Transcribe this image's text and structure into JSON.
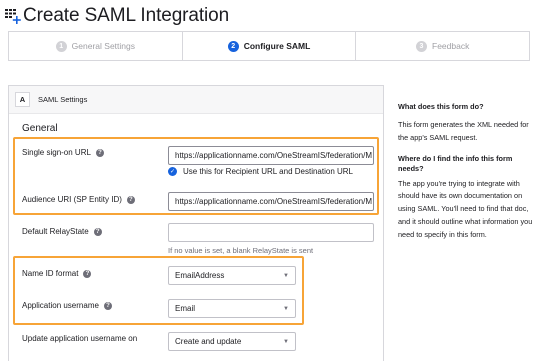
{
  "page": {
    "title": "Create SAML Integration"
  },
  "steps": [
    {
      "num": "1",
      "label": "General Settings"
    },
    {
      "num": "2",
      "label": "Configure SAML"
    },
    {
      "num": "3",
      "label": "Feedback"
    }
  ],
  "card": {
    "badge": "A",
    "header": "SAML Settings",
    "section": "General"
  },
  "fields": {
    "sso_url": {
      "label": "Single sign-on URL",
      "value": "https://applicationname.com/OneStreamIS/federation/M"
    },
    "recipient_check": {
      "label": "Use this for Recipient URL and Destination URL",
      "checked": true
    },
    "audience_uri": {
      "label": "Audience URI (SP Entity ID)",
      "value": "https://applicationname.com/OneStreamIS/federation/M"
    },
    "relay_state": {
      "label": "Default RelayState",
      "value": "",
      "hint": "If no value is set, a blank RelayState is sent"
    },
    "name_id_format": {
      "label": "Name ID format",
      "value": "EmailAddress"
    },
    "app_username": {
      "label": "Application username",
      "value": "Email"
    },
    "update_username": {
      "label": "Update application username on",
      "value": "Create and update"
    }
  },
  "aside": {
    "q1": "What does this form do?",
    "a1": "This form generates the XML needed for the app's SAML request.",
    "q2": "Where do I find the info this form needs?",
    "a2": "The app you're trying to integrate with should have its own documentation on using SAML. You'll need to find that doc, and it should outline what information you need to specify in this form."
  },
  "colors": {
    "accent": "#1662dd",
    "highlight": "#f7a437",
    "border": "#d7d7dc"
  },
  "icons": {
    "title": "app-grid-plus-icon",
    "help": "question-circle-icon",
    "check": "check-circle-icon",
    "caret": "caret-down-icon"
  }
}
